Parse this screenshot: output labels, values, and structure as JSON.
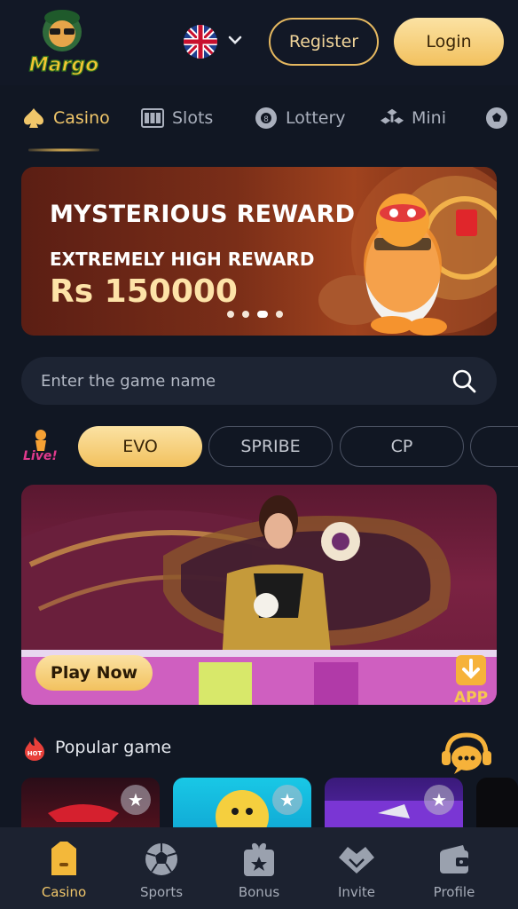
{
  "header": {
    "logo_text": "Margo",
    "language_icon": "uk-flag-icon",
    "register_label": "Register",
    "login_label": "Login"
  },
  "categories": [
    {
      "label": "Casino",
      "icon": "spade-icon",
      "active": true
    },
    {
      "label": "Slots",
      "icon": "slot-machine-icon"
    },
    {
      "label": "Lottery",
      "icon": "lottery-ball-icon"
    },
    {
      "label": "Mini",
      "icon": "mini-games-icon"
    },
    {
      "label": "",
      "icon": "soccer-ball-icon"
    }
  ],
  "banner": {
    "title": "MYSTERIOUS REWARD",
    "subtitle": "EXTREMELY HIGH REWARD",
    "amount": "Rs 150000",
    "slide_count": 4,
    "active_slide": 3
  },
  "search": {
    "placeholder": "Enter the game name"
  },
  "providers": {
    "tabs": [
      "EVO",
      "SPRIBE",
      "CP"
    ],
    "active": "EVO"
  },
  "live_banner": {
    "play_label": "Play Now",
    "app_label": "APP"
  },
  "popular": {
    "title": "Popular game"
  },
  "bottom_nav": [
    {
      "label": "Casino",
      "icon": "casino-icon",
      "active": true
    },
    {
      "label": "Sports",
      "icon": "soccer-ball-icon"
    },
    {
      "label": "Bonus",
      "icon": "gift-icon"
    },
    {
      "label": "Invite",
      "icon": "handshake-icon"
    },
    {
      "label": "Profile",
      "icon": "wallet-icon"
    }
  ],
  "colors": {
    "background": "#111723",
    "accent_gold": "#f0c66a",
    "nav_background": "#1c2230"
  }
}
